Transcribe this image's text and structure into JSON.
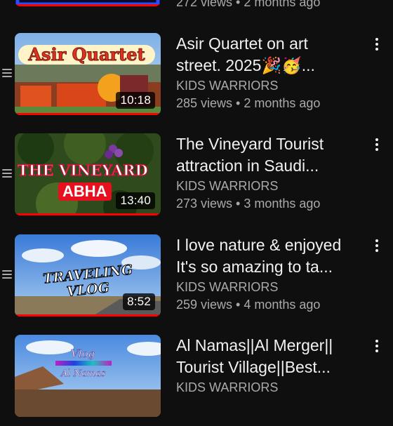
{
  "partial_top": {
    "meta": "272 views • 2 months ago"
  },
  "videos": [
    {
      "title_line1": "Asir Quartet on art",
      "title_line2": "street. 2025🎉🥳...",
      "thumb_text": "Asir Quartet",
      "channel": "KIDS WARRIORS",
      "meta": "285 views • 2 months ago",
      "duration": "10:18",
      "progress": 1.0
    },
    {
      "title_line1": "The Vineyard Tourist",
      "title_line2": "attraction in Saudi...",
      "thumb_text": "THE VINEYARD",
      "thumb_subtext": "ABHA",
      "channel": "KIDS WARRIORS",
      "meta": "273 views • 3 months ago",
      "duration": "13:40",
      "progress": 1.0
    },
    {
      "title_line1": "I love nature & enjoyed",
      "title_line2": "It's so amazing to ta...",
      "thumb_text": "TRAVELING",
      "thumb_subtext": "VLOG",
      "channel": "KIDS WARRIORS",
      "meta": "259 views • 4 months ago",
      "duration": "8:52",
      "progress": 1.0
    },
    {
      "title_line1": "Al Namas||Al Merger||",
      "title_line2": "Tourist Village||Best...",
      "thumb_text": "Vlog",
      "thumb_subtext": "Al Namas",
      "channel": "KIDS WARRIORS",
      "meta": "",
      "duration": "",
      "progress": 0
    }
  ],
  "icons": {
    "drag": "drag-handle-icon",
    "menu": "more-vert-icon"
  },
  "colors": {
    "background": "#0f0f0f",
    "progress": "#ff0000",
    "secondary_text": "#aaaaaa"
  }
}
